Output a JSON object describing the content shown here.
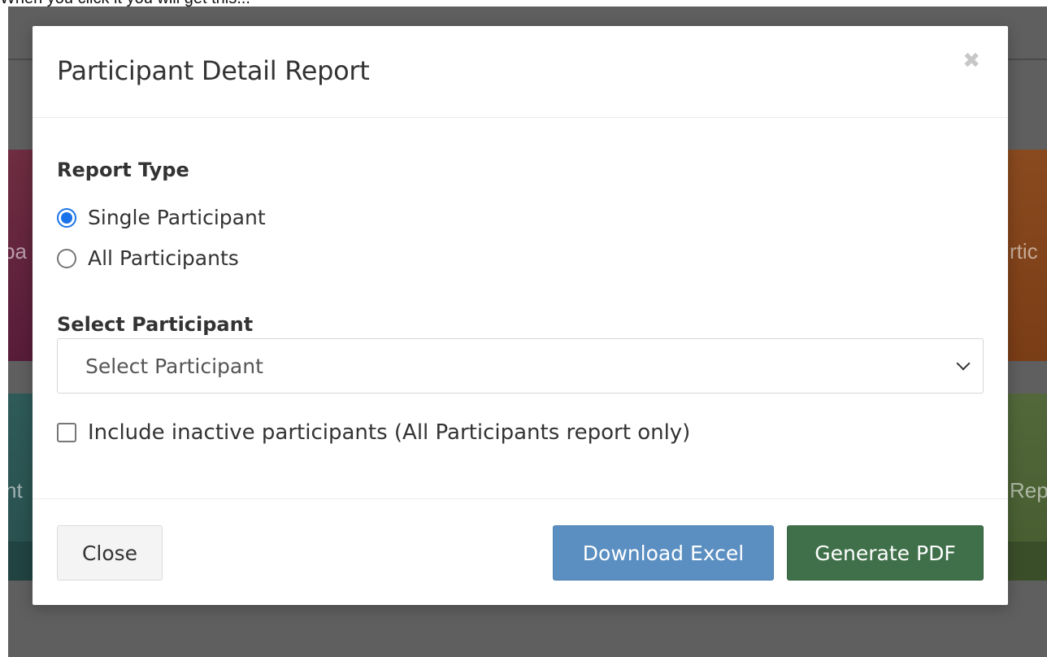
{
  "caption": "When you click it you will get this...",
  "background": {
    "tile_top_left": "pa",
    "tile_top_right": "rtic",
    "tile_bottom_left": "nt",
    "tile_bottom_right": "Rep"
  },
  "modal": {
    "title": "Participant Detail Report",
    "close_symbol": "✖",
    "report_type": {
      "label": "Report Type",
      "options": [
        {
          "label": "Single Participant",
          "checked": true
        },
        {
          "label": "All Participants",
          "checked": false
        }
      ]
    },
    "select_participant": {
      "label": "Select Participant",
      "selected_value": "Select Participant"
    },
    "include_inactive": {
      "label": "Include inactive participants (All Participants report only)",
      "checked": false
    },
    "footer": {
      "close_label": "Close",
      "excel_label": "Download Excel",
      "pdf_label": "Generate PDF"
    }
  },
  "colors": {
    "excel_button": "#5b8fc1",
    "pdf_button": "#3f7049",
    "radio_accent": "#1a73e8",
    "backdrop": "#5f5f5f"
  },
  "icons": {
    "close": "close-icon",
    "select_arrow": "chevron-down-icon"
  }
}
